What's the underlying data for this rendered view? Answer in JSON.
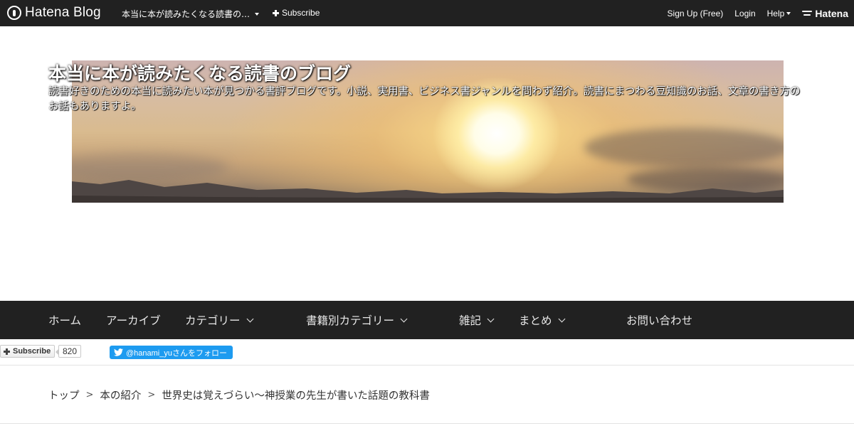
{
  "topbar": {
    "logo_text": "Hatena Blog",
    "blog_name": "本当に本が読みたくなる読書の…",
    "subscribe_label": "Subscribe",
    "signup_label": "Sign Up (Free)",
    "login_label": "Login",
    "help_label": "Help",
    "hatena_label": "Hatena"
  },
  "header": {
    "title": "本当に本が読みたくなる読書のブログ",
    "description": "読書好きのための本当に読みたい本が見つかる書評ブログです。小説、実用書、ビジネス書ジャンルを問わず紹介。読書にまつわる豆知識のお話、文章の書き方のお話もありますよ。"
  },
  "global_nav": {
    "items": [
      {
        "label": "ホーム",
        "has_dropdown": false
      },
      {
        "label": "アーカイブ",
        "has_dropdown": false
      },
      {
        "label": "カテゴリー",
        "has_dropdown": true
      },
      {
        "label": "書籍別カテゴリー",
        "has_dropdown": true
      },
      {
        "label": "雑記",
        "has_dropdown": true
      },
      {
        "label": "まとめ",
        "has_dropdown": true
      },
      {
        "label": "お問い合わせ",
        "has_dropdown": false
      }
    ]
  },
  "widgets": {
    "subscribe_label": "Subscribe",
    "subscriber_count": "820",
    "twitter_follow_label": "@hanami_yuさんをフォロー"
  },
  "breadcrumb": {
    "items": [
      "トップ",
      "本の紹介"
    ],
    "separator": ">",
    "current": "世界史は覚えづらい〜神授業の先生が書いた話題の教科書"
  },
  "colors": {
    "topbar_bg": "#212121",
    "nav_bg": "#212121",
    "twitter_blue": "#1d9bf0"
  }
}
